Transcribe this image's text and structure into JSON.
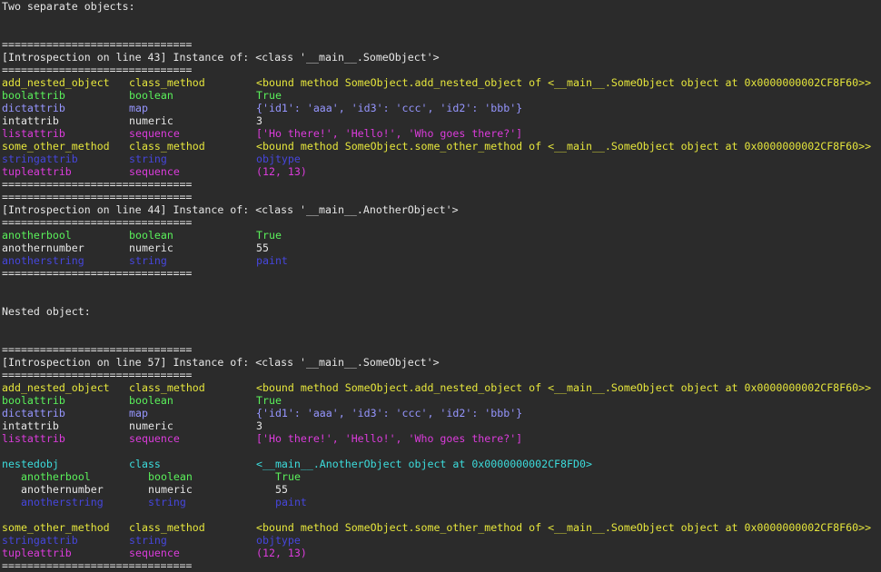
{
  "colors": {
    "background": "#2b2b2b",
    "default": "#e6e6e6",
    "yellow": "#e6e63c",
    "green": "#5af05a",
    "blue_violet": "#9696ff",
    "dark_blue": "#4646dc",
    "magenta": "#dc3cdc",
    "white": "#e6e6e6",
    "cyan": "#3cdcdc"
  },
  "lines": [
    {
      "type": "text",
      "text": "Two separate objects:",
      "color": "default"
    },
    {
      "type": "blank"
    },
    {
      "type": "blank"
    },
    {
      "type": "text",
      "text": "==============================",
      "color": "default"
    },
    {
      "type": "text",
      "text": "[Introspection on line 43] Instance of: <class '__main__.SomeObject'>",
      "color": "default"
    },
    {
      "type": "text",
      "text": "==============================",
      "color": "default"
    },
    {
      "type": "row",
      "name": "add_nested_object",
      "kind": "class_method",
      "value": "<bound method SomeObject.add_nested_object of <__main__.SomeObject object at 0x0000000002CF8F60>>",
      "color": "yellow"
    },
    {
      "type": "row",
      "name": "boolattrib",
      "kind": "boolean",
      "value": "True",
      "color": "green"
    },
    {
      "type": "row",
      "name": "dictattrib",
      "kind": "map",
      "value": "{'id1': 'aaa', 'id3': 'ccc', 'id2': 'bbb'}",
      "color": "blue_violet"
    },
    {
      "type": "row",
      "name": "intattrib",
      "kind": "numeric",
      "value": "3",
      "color": "white"
    },
    {
      "type": "row",
      "name": "listattrib",
      "kind": "sequence",
      "value": "['Ho there!', 'Hello!', 'Who goes there?']",
      "color": "magenta"
    },
    {
      "type": "row",
      "name": "some_other_method",
      "kind": "class_method",
      "value": "<bound method SomeObject.some_other_method of <__main__.SomeObject object at 0x0000000002CF8F60>>",
      "color": "yellow"
    },
    {
      "type": "row",
      "name": "stringattrib",
      "kind": "string",
      "value": "objtype",
      "color": "dark_blue"
    },
    {
      "type": "row",
      "name": "tupleattrib",
      "kind": "sequence",
      "value": "(12, 13)",
      "color": "magenta"
    },
    {
      "type": "text",
      "text": "==============================",
      "color": "default"
    },
    {
      "type": "text",
      "text": "==============================",
      "color": "default"
    },
    {
      "type": "text",
      "text": "[Introspection on line 44] Instance of: <class '__main__.AnotherObject'>",
      "color": "default"
    },
    {
      "type": "text",
      "text": "==============================",
      "color": "default"
    },
    {
      "type": "row",
      "name": "anotherbool",
      "kind": "boolean",
      "value": "True",
      "color": "green"
    },
    {
      "type": "row",
      "name": "anothernumber",
      "kind": "numeric",
      "value": "55",
      "color": "white"
    },
    {
      "type": "row",
      "name": "anotherstring",
      "kind": "string",
      "value": "paint",
      "color": "dark_blue"
    },
    {
      "type": "text",
      "text": "==============================",
      "color": "default"
    },
    {
      "type": "blank"
    },
    {
      "type": "blank"
    },
    {
      "type": "text",
      "text": "Nested object:",
      "color": "default"
    },
    {
      "type": "blank"
    },
    {
      "type": "blank"
    },
    {
      "type": "text",
      "text": "==============================",
      "color": "default"
    },
    {
      "type": "text",
      "text": "[Introspection on line 57] Instance of: <class '__main__.SomeObject'>",
      "color": "default"
    },
    {
      "type": "text",
      "text": "==============================",
      "color": "default"
    },
    {
      "type": "row",
      "name": "add_nested_object",
      "kind": "class_method",
      "value": "<bound method SomeObject.add_nested_object of <__main__.SomeObject object at 0x0000000002CF8F60>>",
      "color": "yellow"
    },
    {
      "type": "row",
      "name": "boolattrib",
      "kind": "boolean",
      "value": "True",
      "color": "green"
    },
    {
      "type": "row",
      "name": "dictattrib",
      "kind": "map",
      "value": "{'id1': 'aaa', 'id3': 'ccc', 'id2': 'bbb'}",
      "color": "blue_violet"
    },
    {
      "type": "row",
      "name": "intattrib",
      "kind": "numeric",
      "value": "3",
      "color": "white"
    },
    {
      "type": "row",
      "name": "listattrib",
      "kind": "sequence",
      "value": "['Ho there!', 'Hello!', 'Who goes there?']",
      "color": "magenta"
    },
    {
      "type": "blank"
    },
    {
      "type": "row",
      "name": "nestedobj",
      "kind": "class",
      "value": "<__main__.AnotherObject object at 0x0000000002CF8FD0>",
      "color": "cyan"
    },
    {
      "type": "row",
      "nested": true,
      "name": "anotherbool",
      "kind": "boolean",
      "value": "True",
      "color": "green"
    },
    {
      "type": "row",
      "nested": true,
      "name": "anothernumber",
      "kind": "numeric",
      "value": "55",
      "color": "white"
    },
    {
      "type": "row",
      "nested": true,
      "name": "anotherstring",
      "kind": "string",
      "value": "paint",
      "color": "dark_blue"
    },
    {
      "type": "blank"
    },
    {
      "type": "row",
      "name": "some_other_method",
      "kind": "class_method",
      "value": "<bound method SomeObject.some_other_method of <__main__.SomeObject object at 0x0000000002CF8F60>>",
      "color": "yellow"
    },
    {
      "type": "row",
      "name": "stringattrib",
      "kind": "string",
      "value": "objtype",
      "color": "dark_blue"
    },
    {
      "type": "row",
      "name": "tupleattrib",
      "kind": "sequence",
      "value": "(12, 13)",
      "color": "magenta"
    },
    {
      "type": "text",
      "text": "==============================",
      "color": "default"
    }
  ]
}
